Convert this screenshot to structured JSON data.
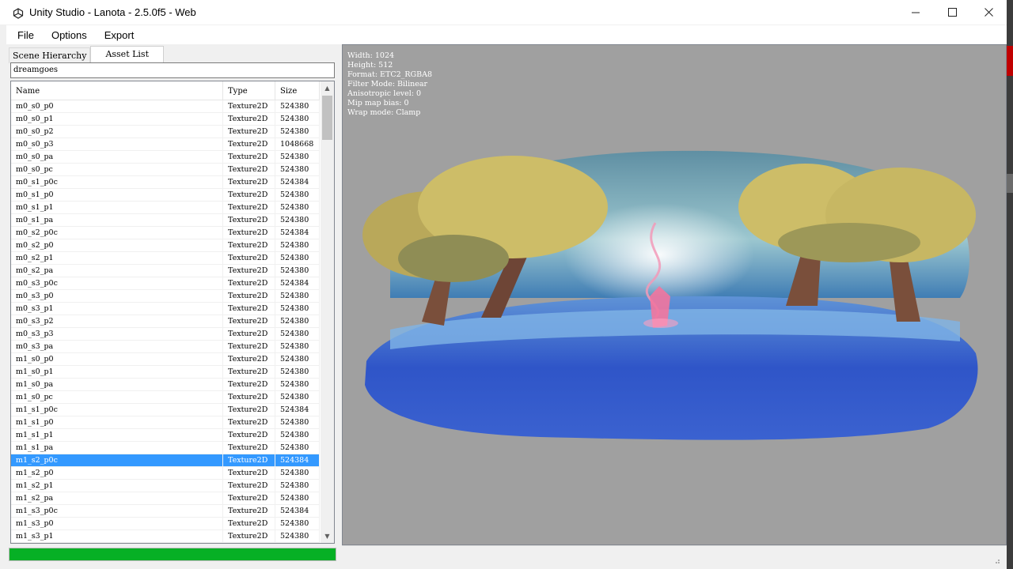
{
  "window": {
    "title": "Unity Studio - Lanota - 2.5.0f5 - Web"
  },
  "menu": [
    "File",
    "Options",
    "Export"
  ],
  "tabs": [
    {
      "label": "Scene Hierarchy",
      "active": false
    },
    {
      "label": "Asset List",
      "active": true
    }
  ],
  "search": {
    "value": "dreamgoes"
  },
  "list": {
    "columns": [
      "Name",
      "Type",
      "Size"
    ],
    "rows": [
      [
        "m0_s0_p0",
        "Texture2D",
        "524380"
      ],
      [
        "m0_s0_p1",
        "Texture2D",
        "524380"
      ],
      [
        "m0_s0_p2",
        "Texture2D",
        "524380"
      ],
      [
        "m0_s0_p3",
        "Texture2D",
        "1048668"
      ],
      [
        "m0_s0_pa",
        "Texture2D",
        "524380"
      ],
      [
        "m0_s0_pc",
        "Texture2D",
        "524380"
      ],
      [
        "m0_s1_p0c",
        "Texture2D",
        "524384"
      ],
      [
        "m0_s1_p0",
        "Texture2D",
        "524380"
      ],
      [
        "m0_s1_p1",
        "Texture2D",
        "524380"
      ],
      [
        "m0_s1_pa",
        "Texture2D",
        "524380"
      ],
      [
        "m0_s2_p0c",
        "Texture2D",
        "524384"
      ],
      [
        "m0_s2_p0",
        "Texture2D",
        "524380"
      ],
      [
        "m0_s2_p1",
        "Texture2D",
        "524380"
      ],
      [
        "m0_s2_pa",
        "Texture2D",
        "524380"
      ],
      [
        "m0_s3_p0c",
        "Texture2D",
        "524384"
      ],
      [
        "m0_s3_p0",
        "Texture2D",
        "524380"
      ],
      [
        "m0_s3_p1",
        "Texture2D",
        "524380"
      ],
      [
        "m0_s3_p2",
        "Texture2D",
        "524380"
      ],
      [
        "m0_s3_p3",
        "Texture2D",
        "524380"
      ],
      [
        "m0_s3_pa",
        "Texture2D",
        "524380"
      ],
      [
        "m1_s0_p0",
        "Texture2D",
        "524380"
      ],
      [
        "m1_s0_p1",
        "Texture2D",
        "524380"
      ],
      [
        "m1_s0_pa",
        "Texture2D",
        "524380"
      ],
      [
        "m1_s0_pc",
        "Texture2D",
        "524380"
      ],
      [
        "m1_s1_p0c",
        "Texture2D",
        "524384"
      ],
      [
        "m1_s1_p0",
        "Texture2D",
        "524380"
      ],
      [
        "m1_s1_p1",
        "Texture2D",
        "524380"
      ],
      [
        "m1_s1_pa",
        "Texture2D",
        "524380"
      ],
      [
        "m1_s2_p0c",
        "Texture2D",
        "524384"
      ],
      [
        "m1_s2_p0",
        "Texture2D",
        "524380"
      ],
      [
        "m1_s2_p1",
        "Texture2D",
        "524380"
      ],
      [
        "m1_s2_pa",
        "Texture2D",
        "524380"
      ],
      [
        "m1_s3_p0c",
        "Texture2D",
        "524384"
      ],
      [
        "m1_s3_p0",
        "Texture2D",
        "524380"
      ],
      [
        "m1_s3_p1",
        "Texture2D",
        "524380"
      ]
    ],
    "selected_index": 28
  },
  "progress": {
    "fraction": 1.0,
    "color": "#06b025"
  },
  "preview": {
    "info": [
      "Width: 1024",
      "Height: 512",
      "Format: ETC2_RGBA8",
      "Filter Mode: Bilinear",
      "Anisotropic level: 0",
      "Mip map bias: 0",
      "Wrap mode: Clamp"
    ]
  },
  "icons": {
    "app": "unity-logo-icon",
    "minimize": "minimize-icon",
    "maximize": "maximize-icon",
    "close": "close-icon"
  },
  "colors": {
    "selection": "#3399ff",
    "preview_bg": "#a0a0a0"
  }
}
